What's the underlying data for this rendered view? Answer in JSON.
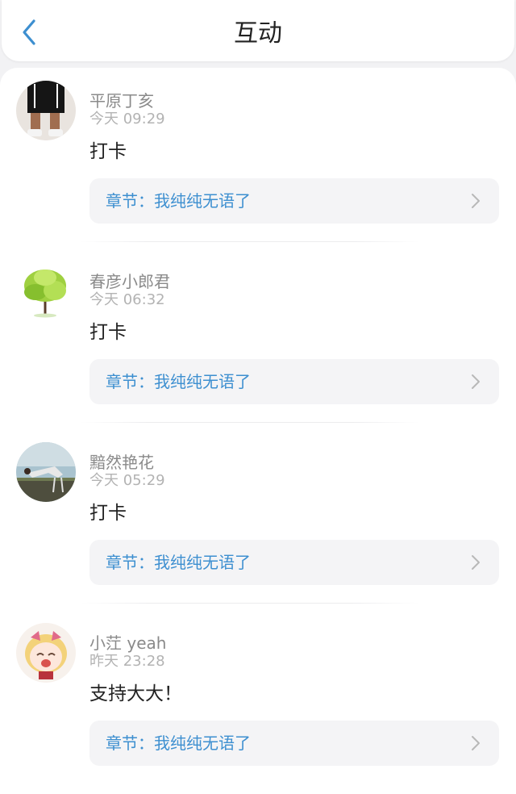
{
  "header": {
    "title": "互动",
    "back_icon": "chevron-left-icon"
  },
  "colors": {
    "accent": "#3d8fd0",
    "background": "#f2f2f4"
  },
  "comments": [
    {
      "username": "平原丁亥",
      "time": "今天 09:29",
      "text": "打卡",
      "chapter": "章节：我纯纯无语了"
    },
    {
      "username": "春彦小郎君",
      "time": "今天 06:32",
      "text": "打卡",
      "chapter": "章节：我纯纯无语了"
    },
    {
      "username": "黯然艳花",
      "time": "今天 05:29",
      "text": "打卡",
      "chapter": "章节：我纯纯无语了"
    },
    {
      "username": "小茳 yeah",
      "time": "昨天 23:28",
      "text": "支持大大！",
      "chapter": "章节：我纯纯无语了"
    }
  ]
}
